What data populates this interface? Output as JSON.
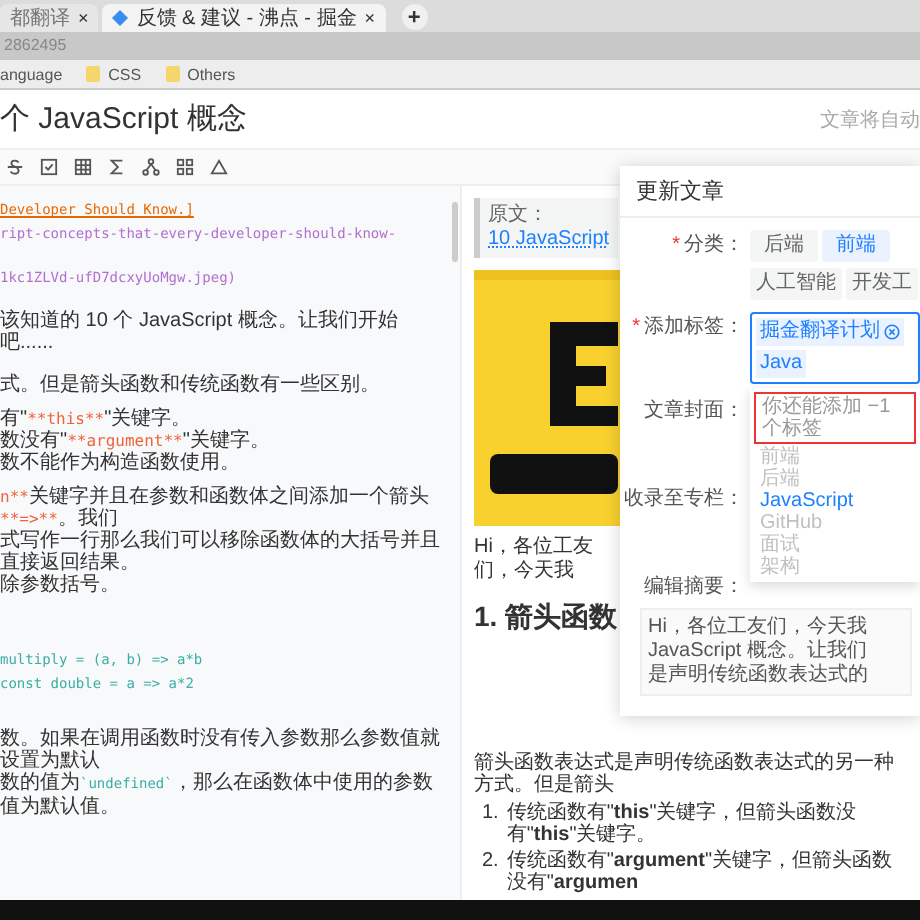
{
  "browser": {
    "tabs": [
      {
        "title": "都翻译",
        "selected": false,
        "has_icon": false
      },
      {
        "title": "反馈 & 建议 - 沸点 - 掘金",
        "selected": true,
        "has_icon": true
      }
    ],
    "new_tab": "+",
    "close_mark": "×",
    "address": "2862495",
    "bookmarks": [
      {
        "label": "anguage",
        "kind": "link"
      },
      {
        "label": "CSS",
        "kind": "folder"
      },
      {
        "label": "Others",
        "kind": "folder"
      }
    ]
  },
  "header": {
    "title": "个 JavaScript 概念",
    "hint": "文章将自动"
  },
  "editor": {
    "blocks": [
      [
        [
          {
            "text": "Developer Should Know.]",
            "kind": "link"
          }
        ],
        [
          {
            "text": "ript-concepts-that-every-developer-should-know-",
            "kind": "url"
          }
        ]
      ],
      [
        [
          {
            "text": "1kc1ZLVd-ufD7dcxyUoMgw.jpeg)",
            "kind": "url"
          }
        ]
      ],
      [
        [
          {
            "text": "该知道的 10 个 JavaScript 概念。让我们开始吧......",
            "kind": "plain"
          }
        ]
      ],
      [
        [
          {
            "text": "式。但是箭头函数和传统函数有一些区别。",
            "kind": "plain"
          }
        ]
      ],
      [
        [
          {
            "text": "有\"",
            "kind": "plain"
          },
          {
            "text": "**this**",
            "kind": "bold"
          },
          {
            "text": "\"关键字。",
            "kind": "plain"
          }
        ],
        [
          {
            "text": "数没有\"",
            "kind": "plain"
          },
          {
            "text": "**argument**",
            "kind": "bold"
          },
          {
            "text": "\"关键字。",
            "kind": "plain"
          }
        ],
        [
          {
            "text": "数不能作为构造函数使用。",
            "kind": "plain"
          }
        ]
      ],
      [
        [
          {
            "text": "n**",
            "kind": "bold"
          },
          {
            "text": "关键字并且在参数和函数体之间添加一个箭头 ",
            "kind": "plain"
          },
          {
            "text": "**=>**",
            "kind": "bold"
          },
          {
            "text": "。我们",
            "kind": "plain"
          }
        ],
        [
          {
            "text": "式写作一行那么我们可以移除函数体的大括号并且直接返回结果。",
            "kind": "plain"
          }
        ],
        [
          {
            "text": "除参数括号。",
            "kind": "plain"
          }
        ]
      ],
      [
        [
          {
            "text": "multiply = (a, b) => a*b",
            "kind": "code"
          }
        ],
        [
          {
            "text": "const double = a => a*2",
            "kind": "code"
          }
        ]
      ],
      [
        [
          {
            "text": "数。如果在调用函数时没有传入参数那么参数值就设置为默认",
            "kind": "plain"
          }
        ],
        [
          {
            "text": "数的值为",
            "kind": "plain"
          },
          {
            "text": "`undefined`",
            "kind": "code"
          },
          {
            "text": "，那么在函数体中使用的参数值为默认值。",
            "kind": "plain"
          }
        ]
      ]
    ]
  },
  "preview": {
    "quote": {
      "label": "原文：",
      "link": "10 JavaScript"
    },
    "intro": "Hi，各位工友们，今天我",
    "heading": "1. 箭头函数",
    "paragraph": "箭头函数表达式是声明传统函数表达式的另一种方式。但是箭头",
    "list": [
      {
        "marker": "1.",
        "text": "传统函数有\"**this**\"关键字，但箭头函数没有\"**this**\"关键字。"
      },
      {
        "marker": "2.",
        "text": "传统函数有\"**argument**\"关键字，但箭头函数没有\"**argumen**"
      }
    ]
  },
  "dialog": {
    "title": "更新文章",
    "category": {
      "star": "*",
      "label": "分类：",
      "options": [
        {
          "label": "后端",
          "selected": false
        },
        {
          "label": "前端",
          "selected": true
        },
        {
          "label": "人工智能",
          "selected": false
        },
        {
          "label": "开发工",
          "selected": false
        }
      ]
    },
    "tags": {
      "star": "*",
      "label": "添加标签：",
      "chips": [
        {
          "label": "掘金翻译计划",
          "removable": true
        },
        {
          "label": "Java",
          "removable": false
        }
      ]
    },
    "dropdown": {
      "hint": "你还能添加 −1 个标签",
      "items": [
        {
          "label": "前端",
          "selected": false
        },
        {
          "label": "后端",
          "selected": false
        },
        {
          "label": "JavaScript",
          "selected": true
        },
        {
          "label": "GitHub",
          "selected": false
        },
        {
          "label": "面试",
          "selected": false
        },
        {
          "label": "架构",
          "selected": false
        }
      ]
    },
    "cover": {
      "label": "文章封面："
    },
    "column": {
      "label": "收录至专栏："
    },
    "summary": {
      "label": "编辑摘要：",
      "lines": [
        "Hi，各位工友们，今天我",
        "JavaScript 概念。让我们",
        "是声明传统函数表达式的"
      ]
    }
  }
}
